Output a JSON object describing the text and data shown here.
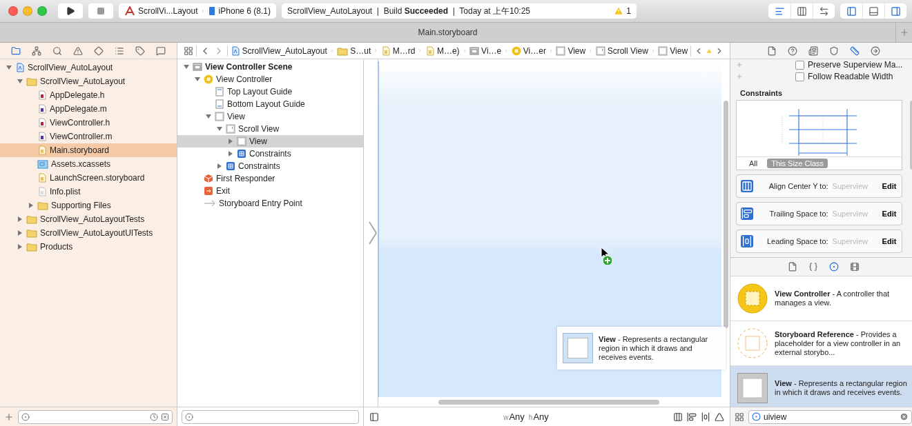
{
  "window": {
    "title": "Main.storyboard"
  },
  "toolbar": {
    "scheme": "ScrollVi...Layout",
    "device": "iPhone 6 (8.1)",
    "status": "ScrollView_AutoLayout  |  Build **Succeeded**  |  Today at 上午10:25",
    "warning_count": "1",
    "editor_modes": [
      {
        "kind": "standard",
        "selected": true
      },
      {
        "kind": "assistant",
        "selected": false
      },
      {
        "kind": "version",
        "selected": false
      }
    ],
    "panels": [
      {
        "kind": "navigator",
        "on": true
      },
      {
        "kind": "debug",
        "on": false
      },
      {
        "kind": "utilities",
        "on": true
      }
    ]
  },
  "navigator": {
    "tabs": [
      {
        "kind": "project",
        "selected": true
      },
      {
        "kind": "symbol",
        "selected": false
      },
      {
        "kind": "find",
        "selected": false
      },
      {
        "kind": "issue",
        "selected": false
      },
      {
        "kind": "test",
        "selected": false
      },
      {
        "kind": "debug",
        "selected": false
      },
      {
        "kind": "breakpoint",
        "selected": false
      },
      {
        "kind": "report",
        "selected": false
      }
    ],
    "items": [
      {
        "kind": "project",
        "label": "ScrollView_AutoLayout",
        "expanded": true,
        "selected": false,
        "children": [
          {
            "kind": "folder",
            "label": "ScrollView_AutoLayout",
            "expanded": true,
            "selected": false,
            "children": [
              {
                "kind": "header",
                "label": "AppDelegate.h",
                "selected": false
              },
              {
                "kind": "source",
                "label": "AppDelegate.m",
                "selected": false
              },
              {
                "kind": "header",
                "label": "ViewController.h",
                "selected": false
              },
              {
                "kind": "source",
                "label": "ViewController.m",
                "selected": false
              },
              {
                "kind": "storyboard",
                "label": "Main.storyboard",
                "selected": true
              },
              {
                "kind": "assets",
                "label": "Assets.xcassets",
                "selected": false
              },
              {
                "kind": "storyboard",
                "label": "LaunchScreen.storyboard",
                "selected": false
              },
              {
                "kind": "plist",
                "label": "Info.plist",
                "selected": false
              },
              {
                "kind": "folder",
                "label": "Supporting Files",
                "expanded": false,
                "selected": false
              }
            ]
          },
          {
            "kind": "folder",
            "label": "ScrollView_AutoLayoutTests",
            "expanded": false,
            "selected": false
          },
          {
            "kind": "folder",
            "label": "ScrollView_AutoLayoutUITests",
            "expanded": false,
            "selected": false
          },
          {
            "kind": "folder",
            "label": "Products",
            "expanded": false,
            "selected": false
          }
        ]
      }
    ]
  },
  "jump_bar": {
    "items": [
      {
        "kind": "project",
        "label": "ScrollView_AutoLayout"
      },
      {
        "kind": "folder",
        "label": "S…ut"
      },
      {
        "kind": "storyboard",
        "label": "M…rd"
      },
      {
        "kind": "storyboard",
        "label": "M…e)"
      },
      {
        "kind": "scene",
        "label": "Vi…e"
      },
      {
        "kind": "controller",
        "label": "Vi…er"
      },
      {
        "kind": "view",
        "label": "View"
      },
      {
        "kind": "scrollview",
        "label": "Scroll View"
      },
      {
        "kind": "view",
        "label": "View"
      }
    ]
  },
  "outline": {
    "items": [
      {
        "kind": "scene",
        "label": "View Controller Scene",
        "expanded": true,
        "selected": false,
        "children": [
          {
            "kind": "controller",
            "label": "View Controller",
            "expanded": true,
            "selected": false,
            "children": [
              {
                "kind": "guide-top",
                "label": "Top Layout Guide",
                "selected": false
              },
              {
                "kind": "guide-bottom",
                "label": "Bottom Layout Guide",
                "selected": false
              },
              {
                "kind": "view",
                "label": "View",
                "expanded": true,
                "selected": false,
                "children": [
                  {
                    "kind": "scrollview",
                    "label": "Scroll View",
                    "expanded": true,
                    "selected": false,
                    "children": [
                      {
                        "kind": "view",
                        "label": "View",
                        "expanded": false,
                        "selected": true
                      },
                      {
                        "kind": "constraints",
                        "label": "Constraints",
                        "expanded": false,
                        "selected": false
                      }
                    ]
                  },
                  {
                    "kind": "constraints",
                    "label": "Constraints",
                    "expanded": false,
                    "selected": false
                  }
                ]
              }
            ]
          },
          {
            "kind": "responder",
            "label": "First Responder",
            "selected": false
          },
          {
            "kind": "exit",
            "label": "Exit",
            "selected": false
          },
          {
            "kind": "entry",
            "label": "Storyboard Entry Point",
            "selected": false
          }
        ]
      }
    ]
  },
  "canvas": {
    "drag_preview": "**View** - Represents a rectangular region in which it draws and receives events.",
    "size_class": [
      {
        "prefix": "w",
        "value": "Any"
      },
      {
        "prefix": "h",
        "value": "Any"
      }
    ]
  },
  "inspector": {
    "tabs": [
      {
        "kind": "file",
        "selected": false
      },
      {
        "kind": "help",
        "selected": false
      },
      {
        "kind": "identity",
        "selected": false
      },
      {
        "kind": "attributes",
        "selected": false
      },
      {
        "kind": "size",
        "selected": true
      },
      {
        "kind": "connections",
        "selected": false
      }
    ],
    "options": [
      {
        "label": "Preserve Superview Ma...",
        "checked": false
      },
      {
        "label": "Follow Readable Width",
        "checked": false
      }
    ],
    "constraints": {
      "title": "Constraints",
      "filters": [
        {
          "label": "All",
          "selected": false
        },
        {
          "label": "This Size Class",
          "selected": true
        }
      ],
      "items": [
        {
          "kind": "center-y",
          "label": "Align Center Y to:",
          "target": "Superview",
          "action": "Edit"
        },
        {
          "kind": "trailing",
          "label": "Trailing Space to:",
          "target": "Superview",
          "action": "Edit"
        },
        {
          "kind": "leading",
          "label": "Leading Space to:",
          "target": "Superview",
          "action": "Edit"
        }
      ]
    }
  },
  "library": {
    "tabs": [
      {
        "kind": "file",
        "selected": false
      },
      {
        "kind": "code",
        "selected": false
      },
      {
        "kind": "object",
        "selected": true
      },
      {
        "kind": "media",
        "selected": false
      }
    ],
    "items": [
      {
        "kind": "view-controller",
        "text": "**View Controller** - A controller that manages a view.",
        "selected": false
      },
      {
        "kind": "storyboard-reference",
        "text": "**Storyboard Reference** - Provides a placeholder for a view controller in an external storybo...",
        "selected": false
      },
      {
        "kind": "view",
        "text": "**View** - Represents a rectangular region in which it draws and receives events.",
        "selected": true
      }
    ],
    "search": "uiview"
  }
}
